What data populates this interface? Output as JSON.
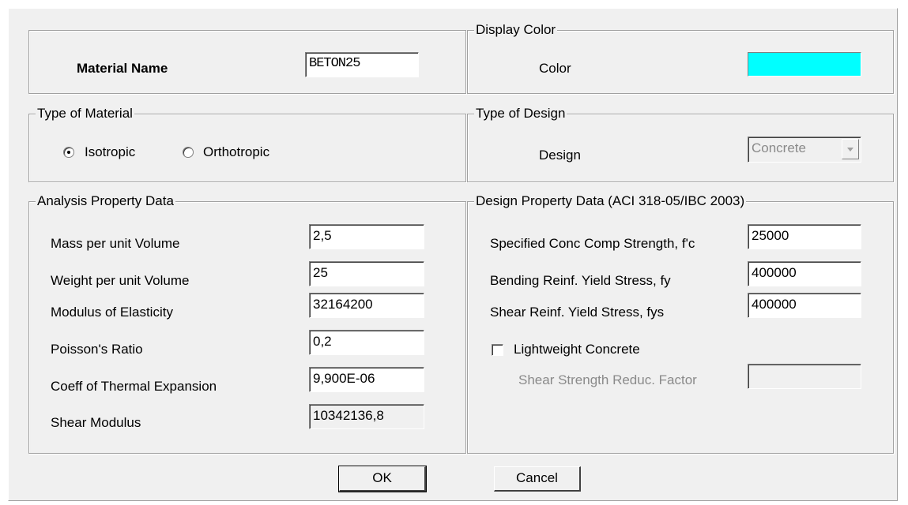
{
  "material_name": {
    "label": "Material Name",
    "value": "BETON25"
  },
  "display_color": {
    "group_title": "Display Color",
    "label": "Color",
    "color": "#00ffff"
  },
  "type_of_material": {
    "group_title": "Type of Material",
    "options": [
      "Isotropic",
      "Orthotropic"
    ],
    "selected": "Isotropic"
  },
  "type_of_design": {
    "group_title": "Type of Design",
    "label": "Design",
    "value": "Concrete"
  },
  "analysis_property_data": {
    "group_title": "Analysis Property Data",
    "fields": [
      {
        "label": "Mass per unit Volume",
        "value": "2,5"
      },
      {
        "label": "Weight per unit Volume",
        "value": "25"
      },
      {
        "label": "Modulus of Elasticity",
        "value": "32164200"
      },
      {
        "label": "Poisson's Ratio",
        "value": "0,2"
      },
      {
        "label": "Coeff of Thermal Expansion",
        "value": "9,900E-06"
      },
      {
        "label": "Shear Modulus",
        "value": "10342136,8"
      }
    ]
  },
  "design_property_data": {
    "group_title": "Design Property Data (ACI 318-05/IBC 2003)",
    "fields": [
      {
        "label": "Specified Conc Comp Strength, f'c",
        "value": "25000"
      },
      {
        "label": "Bending Reinf. Yield Stress, fy",
        "value": "400000"
      },
      {
        "label": "Shear Reinf. Yield Stress, fys",
        "value": "400000"
      }
    ],
    "lightweight_label": "Lightweight Concrete",
    "lightweight_checked": false,
    "shear_reduc_label": "Shear Strength Reduc. Factor",
    "shear_reduc_value": ""
  },
  "buttons": {
    "ok": "OK",
    "cancel": "Cancel"
  }
}
